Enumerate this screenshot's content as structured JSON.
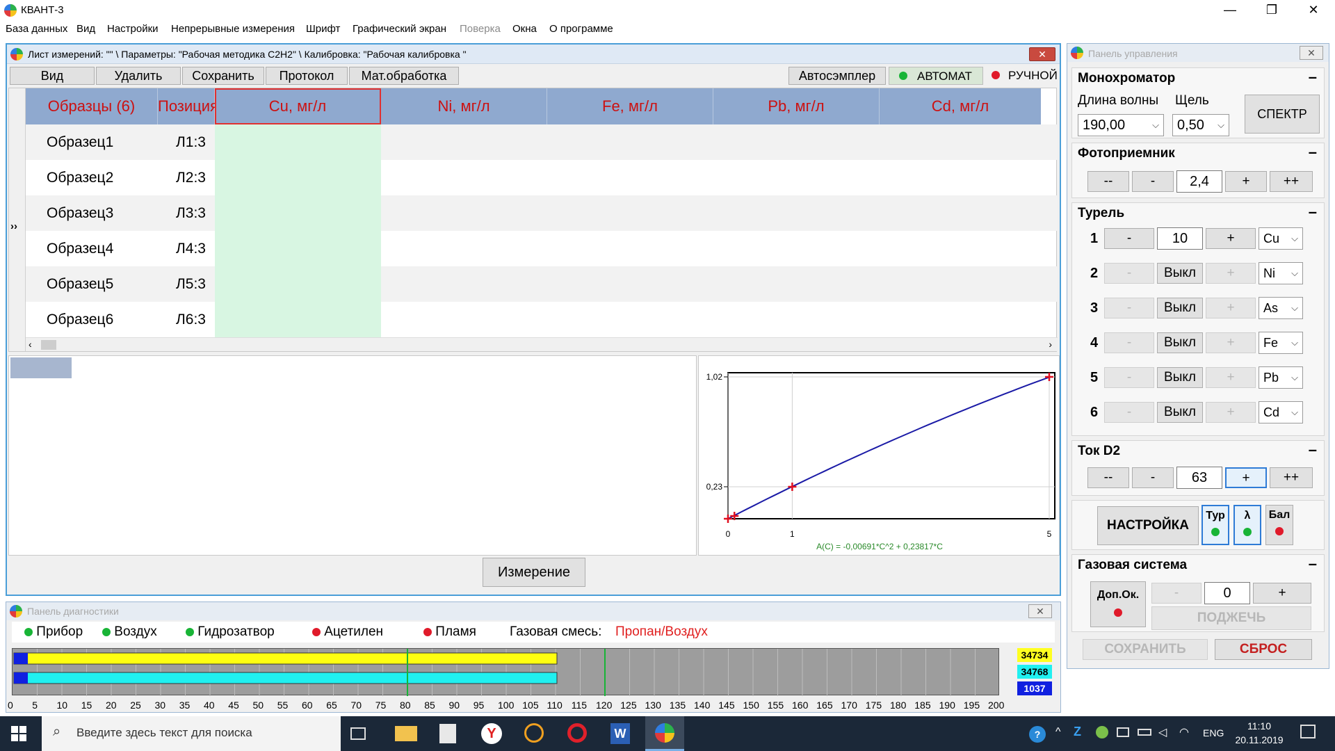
{
  "app": {
    "title": "КВАНТ-3"
  },
  "menu": [
    "База данных",
    "Вид",
    "Настройки",
    "Непрерывные измерения",
    "Шрифт",
    "Графический экран",
    "Поверка",
    "Окна",
    "О программе"
  ],
  "measure_window": {
    "title": "Лист измерений: \"\"  \\  Параметры: \"Рабочая методика С2Н2\"  \\  Калибровка: \"Рабочая калибровка \"",
    "toolbar": {
      "view": "Вид",
      "delete": "Удалить",
      "save": "Сохранить",
      "protocol": "Протокол",
      "math": "Мат.обработка",
      "autosampler": "Автосэмплер",
      "auto": "АВТОМАТ",
      "manual": "РУЧНОЙ"
    },
    "columns": [
      "Образцы (6)",
      "Позиция",
      "Cu, мг/л",
      "Ni, мг/л",
      "Fe, мг/л",
      "Pb, мг/л",
      "Cd, мг/л"
    ],
    "rows": [
      {
        "sample": "Образец1",
        "pos": "Л1:3"
      },
      {
        "sample": "Образец2",
        "pos": "Л2:3"
      },
      {
        "sample": "Образец3",
        "pos": "Л3:3"
      },
      {
        "sample": "Образец4",
        "pos": "Л4:3"
      },
      {
        "sample": "Образец5",
        "pos": "Л5:3"
      },
      {
        "sample": "Образец6",
        "pos": "Л6:3"
      }
    ],
    "expander": "››",
    "measure_btn": "Измерение"
  },
  "chart_data": {
    "type": "line",
    "x": [
      0,
      0.1,
      1,
      5
    ],
    "y": [
      0,
      0.02,
      0.23,
      1.02
    ],
    "xticks": [
      "0",
      "1",
      "5"
    ],
    "yticks": [
      "0,23",
      "1,02"
    ],
    "xlim": [
      0,
      5
    ],
    "ylim": [
      0,
      1.02
    ],
    "formula": "A(C) = -0,00691*C^2 + 0,23817*C",
    "line_color": "#1a1aa6",
    "point_color": "#e01020",
    "formula_color": "#2a8a2a"
  },
  "diag": {
    "title": "Панель диагностики",
    "statuses": [
      {
        "label": "Прибор",
        "state": "green"
      },
      {
        "label": "Воздух",
        "state": "green"
      },
      {
        "label": "Гидрозатвор",
        "state": "green"
      },
      {
        "label": "Ацетилен",
        "state": "red"
      },
      {
        "label": "Пламя",
        "state": "red"
      }
    ],
    "gas_label": "Газовая смесь:",
    "gas_value": "Пропан/Воздух",
    "scale": [
      "0",
      "5",
      "10",
      "15",
      "20",
      "25",
      "30",
      "35",
      "40",
      "45",
      "50",
      "55",
      "60",
      "65",
      "70",
      "75",
      "80",
      "85",
      "90",
      "95",
      "100",
      "105",
      "110",
      "115",
      "120",
      "125",
      "130",
      "135",
      "140",
      "145",
      "150",
      "155",
      "160",
      "165",
      "170",
      "175",
      "180",
      "185",
      "190",
      "195",
      "200"
    ],
    "values": [
      "34734",
      "34768",
      "1037"
    ],
    "bar1_fill": 0.55,
    "bar2_fill": 0.55,
    "marker1": 80,
    "marker2": 120
  },
  "cpanel": {
    "title": "Панель управления",
    "mono": {
      "title": "Монохроматор",
      "wl_label": "Длина волны",
      "slit_label": "Щель",
      "wl": "190,00",
      "slit": "0,50",
      "spectrum": "СПЕКТР"
    },
    "photo": {
      "title": "Фотоприемник",
      "mm": "--",
      "m": "-",
      "val": "2,4",
      "p": "+",
      "pp": "++"
    },
    "turret": {
      "title": "Турель",
      "rows": [
        {
          "n": "1",
          "val": "10",
          "el": "Cu",
          "active": true
        },
        {
          "n": "2",
          "val": "Выкл",
          "el": "Ni",
          "active": false
        },
        {
          "n": "3",
          "val": "Выкл",
          "el": "As",
          "active": false
        },
        {
          "n": "4",
          "val": "Выкл",
          "el": "Fe",
          "active": false
        },
        {
          "n": "5",
          "val": "Выкл",
          "el": "Pb",
          "active": false
        },
        {
          "n": "6",
          "val": "Выкл",
          "el": "Cd",
          "active": false
        }
      ]
    },
    "d2": {
      "title": "Ток D2",
      "mm": "--",
      "m": "-",
      "val": "63",
      "p": "+",
      "pp": "++"
    },
    "setup": {
      "btn": "НАСТРОЙКА",
      "tur": "Тур",
      "lam": "λ",
      "bal": "Бал"
    },
    "gas": {
      "title": "Газовая система",
      "dop": "Доп.Ок.",
      "m": "-",
      "val": "0",
      "p": "+",
      "ignite": "ПОДЖЕЧЬ"
    },
    "save": "СОХРАНИТЬ",
    "reset": "СБРОС"
  },
  "taskbar": {
    "search_placeholder": "Введите здесь текст для поиска",
    "lang": "ENG",
    "time": "11:10",
    "date": "20.11.2019"
  }
}
